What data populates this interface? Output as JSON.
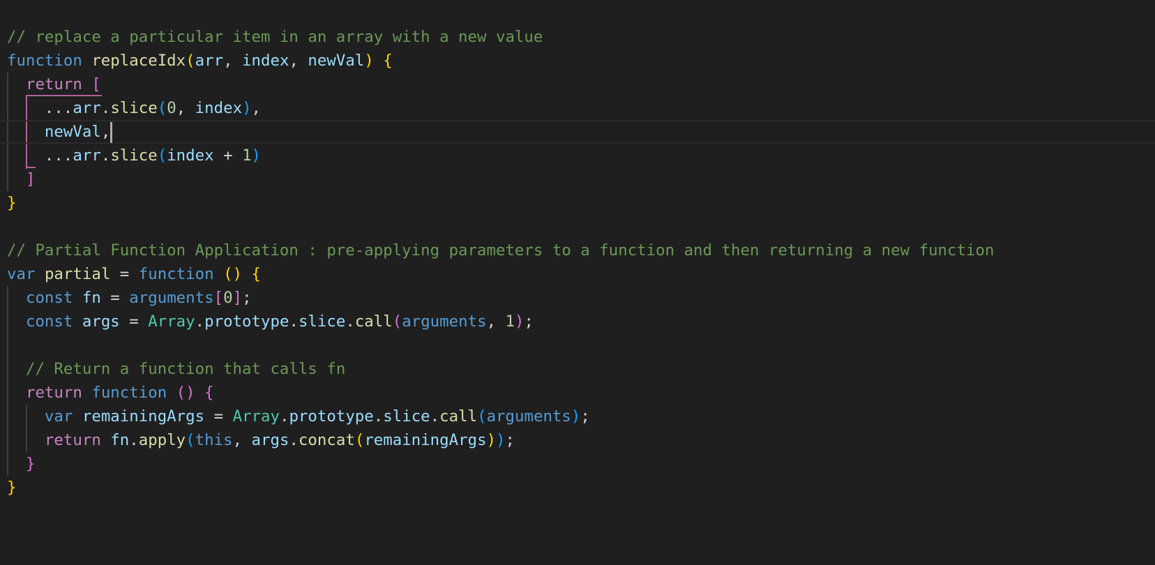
{
  "editor": {
    "language": "javascript",
    "cursor": {
      "line": 5,
      "after_text": "newVal,"
    },
    "colors": {
      "background": "#1f1f1f",
      "comment": "#6a9955",
      "keyword": "#569cd6",
      "control": "#c586c0",
      "function": "#dcdcaa",
      "variable": "#9cdcfe",
      "class": "#4ec9b0",
      "number": "#b5cea8",
      "punctuation": "#d4d4d4",
      "bracket1": "#ffd700",
      "bracket2": "#da70d6",
      "bracket3": "#179fff",
      "this": "#569cd6"
    },
    "lines": [
      {
        "tokens": []
      },
      {
        "tokens": [
          {
            "t": "// replace a particular item in an array with a new value",
            "c": "comment"
          }
        ]
      },
      {
        "tokens": [
          {
            "t": "function",
            "c": "keyword"
          },
          {
            "t": " ",
            "c": "punctuation"
          },
          {
            "t": "replaceIdx",
            "c": "function"
          },
          {
            "t": "(",
            "c": "bracket1"
          },
          {
            "t": "arr",
            "c": "variable"
          },
          {
            "t": ", ",
            "c": "punctuation"
          },
          {
            "t": "index",
            "c": "variable"
          },
          {
            "t": ", ",
            "c": "punctuation"
          },
          {
            "t": "newVal",
            "c": "variable"
          },
          {
            "t": ")",
            "c": "bracket1"
          },
          {
            "t": " ",
            "c": "punctuation"
          },
          {
            "t": "{",
            "c": "bracket1"
          }
        ]
      },
      {
        "tokens": [
          {
            "t": "  ",
            "c": "punctuation"
          },
          {
            "t": "return",
            "c": "control"
          },
          {
            "t": " ",
            "c": "punctuation"
          },
          {
            "t": "[",
            "c": "bracket2"
          }
        ]
      },
      {
        "tokens": [
          {
            "t": "    ...",
            "c": "punctuation"
          },
          {
            "t": "arr",
            "c": "variable"
          },
          {
            "t": ".",
            "c": "punctuation"
          },
          {
            "t": "slice",
            "c": "function"
          },
          {
            "t": "(",
            "c": "bracket3"
          },
          {
            "t": "0",
            "c": "number"
          },
          {
            "t": ", ",
            "c": "punctuation"
          },
          {
            "t": "index",
            "c": "variable"
          },
          {
            "t": ")",
            "c": "bracket3"
          },
          {
            "t": ",",
            "c": "punctuation"
          }
        ]
      },
      {
        "tokens": [
          {
            "t": "    ",
            "c": "punctuation"
          },
          {
            "t": "newVal",
            "c": "variable"
          },
          {
            "t": ",",
            "c": "punctuation"
          }
        ]
      },
      {
        "tokens": [
          {
            "t": "    ...",
            "c": "punctuation"
          },
          {
            "t": "arr",
            "c": "variable"
          },
          {
            "t": ".",
            "c": "punctuation"
          },
          {
            "t": "slice",
            "c": "function"
          },
          {
            "t": "(",
            "c": "bracket3"
          },
          {
            "t": "index",
            "c": "variable"
          },
          {
            "t": " + ",
            "c": "punctuation"
          },
          {
            "t": "1",
            "c": "number"
          },
          {
            "t": ")",
            "c": "bracket3"
          }
        ]
      },
      {
        "tokens": [
          {
            "t": "  ",
            "c": "punctuation"
          },
          {
            "t": "]",
            "c": "bracket2"
          }
        ]
      },
      {
        "tokens": [
          {
            "t": "}",
            "c": "bracket1"
          }
        ]
      },
      {
        "tokens": []
      },
      {
        "tokens": [
          {
            "t": "// Partial Function Application : pre-applying parameters to a function and then returning a new function",
            "c": "comment"
          }
        ]
      },
      {
        "tokens": [
          {
            "t": "var",
            "c": "keyword"
          },
          {
            "t": " ",
            "c": "punctuation"
          },
          {
            "t": "partial",
            "c": "function"
          },
          {
            "t": " = ",
            "c": "punctuation"
          },
          {
            "t": "function",
            "c": "keyword"
          },
          {
            "t": " ",
            "c": "punctuation"
          },
          {
            "t": "()",
            "c": "bracket1"
          },
          {
            "t": " ",
            "c": "punctuation"
          },
          {
            "t": "{",
            "c": "bracket1"
          }
        ]
      },
      {
        "tokens": [
          {
            "t": "  ",
            "c": "punctuation"
          },
          {
            "t": "const",
            "c": "keyword"
          },
          {
            "t": " ",
            "c": "punctuation"
          },
          {
            "t": "fn",
            "c": "variable"
          },
          {
            "t": " = ",
            "c": "punctuation"
          },
          {
            "t": "arguments",
            "c": "keyword"
          },
          {
            "t": "[",
            "c": "bracket2"
          },
          {
            "t": "0",
            "c": "number"
          },
          {
            "t": "]",
            "c": "bracket2"
          },
          {
            "t": ";",
            "c": "punctuation"
          }
        ]
      },
      {
        "tokens": [
          {
            "t": "  ",
            "c": "punctuation"
          },
          {
            "t": "const",
            "c": "keyword"
          },
          {
            "t": " ",
            "c": "punctuation"
          },
          {
            "t": "args",
            "c": "variable"
          },
          {
            "t": " = ",
            "c": "punctuation"
          },
          {
            "t": "Array",
            "c": "class"
          },
          {
            "t": ".",
            "c": "punctuation"
          },
          {
            "t": "prototype",
            "c": "variable"
          },
          {
            "t": ".",
            "c": "punctuation"
          },
          {
            "t": "slice",
            "c": "variable"
          },
          {
            "t": ".",
            "c": "punctuation"
          },
          {
            "t": "call",
            "c": "function"
          },
          {
            "t": "(",
            "c": "bracket2"
          },
          {
            "t": "arguments",
            "c": "keyword"
          },
          {
            "t": ", ",
            "c": "punctuation"
          },
          {
            "t": "1",
            "c": "number"
          },
          {
            "t": ")",
            "c": "bracket2"
          },
          {
            "t": ";",
            "c": "punctuation"
          }
        ]
      },
      {
        "tokens": []
      },
      {
        "tokens": [
          {
            "t": "  ",
            "c": "punctuation"
          },
          {
            "t": "// Return a function that calls fn",
            "c": "comment"
          }
        ]
      },
      {
        "tokens": [
          {
            "t": "  ",
            "c": "punctuation"
          },
          {
            "t": "return",
            "c": "control"
          },
          {
            "t": " ",
            "c": "punctuation"
          },
          {
            "t": "function",
            "c": "keyword"
          },
          {
            "t": " ",
            "c": "punctuation"
          },
          {
            "t": "()",
            "c": "bracket2"
          },
          {
            "t": " ",
            "c": "punctuation"
          },
          {
            "t": "{",
            "c": "bracket2"
          }
        ]
      },
      {
        "tokens": [
          {
            "t": "    ",
            "c": "punctuation"
          },
          {
            "t": "var",
            "c": "keyword"
          },
          {
            "t": " ",
            "c": "punctuation"
          },
          {
            "t": "remainingArgs",
            "c": "variable"
          },
          {
            "t": " = ",
            "c": "punctuation"
          },
          {
            "t": "Array",
            "c": "class"
          },
          {
            "t": ".",
            "c": "punctuation"
          },
          {
            "t": "prototype",
            "c": "variable"
          },
          {
            "t": ".",
            "c": "punctuation"
          },
          {
            "t": "slice",
            "c": "variable"
          },
          {
            "t": ".",
            "c": "punctuation"
          },
          {
            "t": "call",
            "c": "function"
          },
          {
            "t": "(",
            "c": "bracket3"
          },
          {
            "t": "arguments",
            "c": "keyword"
          },
          {
            "t": ")",
            "c": "bracket3"
          },
          {
            "t": ";",
            "c": "punctuation"
          }
        ]
      },
      {
        "tokens": [
          {
            "t": "    ",
            "c": "punctuation"
          },
          {
            "t": "return",
            "c": "control"
          },
          {
            "t": " ",
            "c": "punctuation"
          },
          {
            "t": "fn",
            "c": "variable"
          },
          {
            "t": ".",
            "c": "punctuation"
          },
          {
            "t": "apply",
            "c": "function"
          },
          {
            "t": "(",
            "c": "bracket3"
          },
          {
            "t": "this",
            "c": "this"
          },
          {
            "t": ", ",
            "c": "punctuation"
          },
          {
            "t": "args",
            "c": "variable"
          },
          {
            "t": ".",
            "c": "punctuation"
          },
          {
            "t": "concat",
            "c": "function"
          },
          {
            "t": "(",
            "c": "bracket1"
          },
          {
            "t": "remainingArgs",
            "c": "variable"
          },
          {
            "t": ")",
            "c": "bracket1"
          },
          {
            "t": ")",
            "c": "bracket3"
          },
          {
            "t": ";",
            "c": "punctuation"
          }
        ]
      },
      {
        "tokens": [
          {
            "t": "  ",
            "c": "punctuation"
          },
          {
            "t": "}",
            "c": "bracket2"
          }
        ]
      },
      {
        "tokens": [
          {
            "t": "}",
            "c": "bracket1"
          }
        ]
      }
    ]
  }
}
